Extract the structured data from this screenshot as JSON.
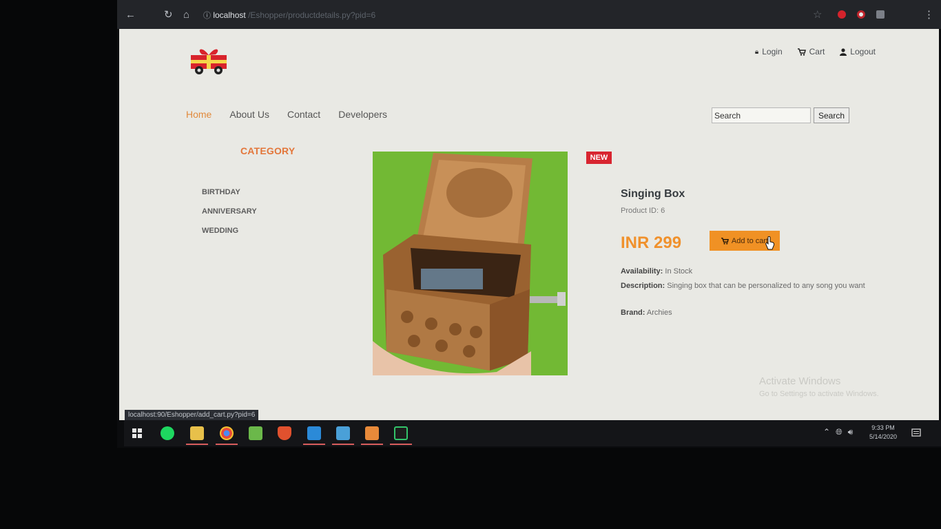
{
  "browser": {
    "url_host": "localhost",
    "url_path": "/Eshopper/productdetails.py?pid=6",
    "status_link": "localhost:90/Eshopper/add_cart.py?pid=6"
  },
  "header": {
    "links": [
      {
        "label": "Login",
        "icon": "lock-icon"
      },
      {
        "label": "Cart",
        "icon": "cart-icon"
      },
      {
        "label": "Logout",
        "icon": "user-icon"
      }
    ]
  },
  "nav": {
    "items": [
      "Home",
      "About Us",
      "Contact",
      "Developers"
    ],
    "active": "Home"
  },
  "search": {
    "placeholder": "Search",
    "button_label": "Search"
  },
  "sidebar": {
    "title": "CATEGORY",
    "items": [
      "BIRTHDAY",
      "ANNIVERSARY",
      "WEDDING"
    ]
  },
  "product": {
    "badge": "NEW",
    "name": "Singing Box",
    "id_label": "Product ID: 6",
    "price": "INR 299",
    "add_to_cart_label": "Add to cart",
    "availability_label": "Availability:",
    "availability_value": "In Stock",
    "description_label": "Description:",
    "description_value": "Singing box that can be personalized to any song you want",
    "brand_label": "Brand:",
    "brand_value": "Archies"
  },
  "watermark": {
    "line1": "Activate Windows",
    "line2": "Go to Settings to activate Windows."
  },
  "taskbar": {
    "time": "9:33 PM",
    "date": "5/14/2020"
  },
  "colors": {
    "accent": "#f09124",
    "badge": "#d82530",
    "category_title": "#e3763a"
  }
}
